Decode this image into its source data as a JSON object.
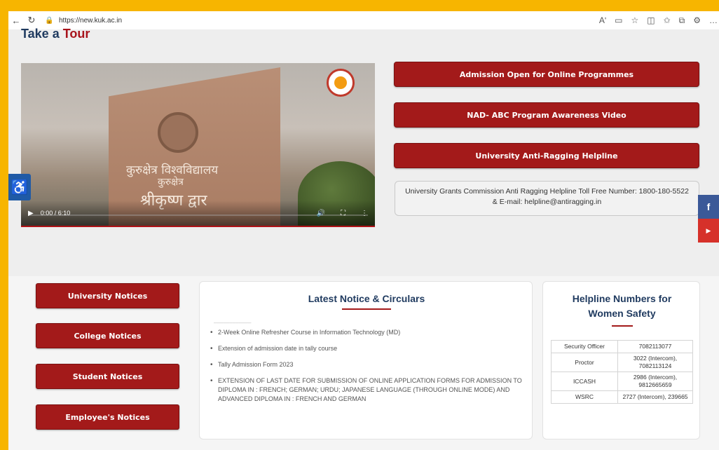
{
  "browser": {
    "url": "https://new.kuk.ac.in",
    "read_aloud_label": "Aʹ"
  },
  "tour": {
    "title_prefix": "Take a",
    "title_accent": "Tour"
  },
  "video": {
    "time": "0:00 / 6:10",
    "gate_line1": "कुरुक्षेत्र विश्वविद्यालय",
    "gate_line2": "कुरुक्षेत्र",
    "gate_line3": "श्रीकृष्ण द्वार"
  },
  "quick_links": [
    {
      "label": "Admission Open for Online Programmes"
    },
    {
      "label": "NAD- ABC Program Awareness Video"
    },
    {
      "label": "University Anti-Ragging Helpline"
    }
  ],
  "anti_ragging_note": "University Grants Commission Anti Ragging Helpline Toll Free Number: 1800-180-5522 & E-mail: helpline@antiragging.in",
  "notice_buttons": [
    {
      "label": "University Notices"
    },
    {
      "label": "College Notices"
    },
    {
      "label": "Student Notices"
    },
    {
      "label": "Employee's Notices"
    }
  ],
  "latest_notices": {
    "title": "Latest Notice & Circulars",
    "items": [
      "2-Week Online Refresher Course in Information Technology (MD)",
      "Extension of admission date in tally course",
      "Tally Admission Form 2023",
      "EXTENSION OF LAST DATE FOR SUBMISSION OF ONLINE APPLICATION FORMS FOR ADMISSION TO DIPLOMA IN : FRENCH; GERMAN; URDU; JAPANESE LANGUAGE (THROUGH ONLINE MODE) AND ADVANCED DIPLOMA IN : FRENCH AND GERMAN"
    ]
  },
  "women_safety": {
    "title_line1": "Helpline Numbers for",
    "title_line2": "Women Safety",
    "rows": [
      {
        "role": "Security Officer",
        "number": "7082113077"
      },
      {
        "role": "Proctor",
        "number": "3022 (Intercom), 7082113124"
      },
      {
        "role": "ICCASH",
        "number": "2986 (Intercom), 9812665659"
      },
      {
        "role": "WSRC",
        "number": "2727 (Intercom), 239665"
      }
    ]
  },
  "colors": {
    "accent": "#a31a1a",
    "heading": "#1f3a5f",
    "frame": "#f7b500"
  },
  "icons": {
    "back": "back-arrow-icon",
    "refresh": "refresh-icon",
    "lock": "lock-icon",
    "accessibility": "accessibility-icon",
    "facebook": "facebook-icon",
    "youtube": "youtube-icon"
  }
}
